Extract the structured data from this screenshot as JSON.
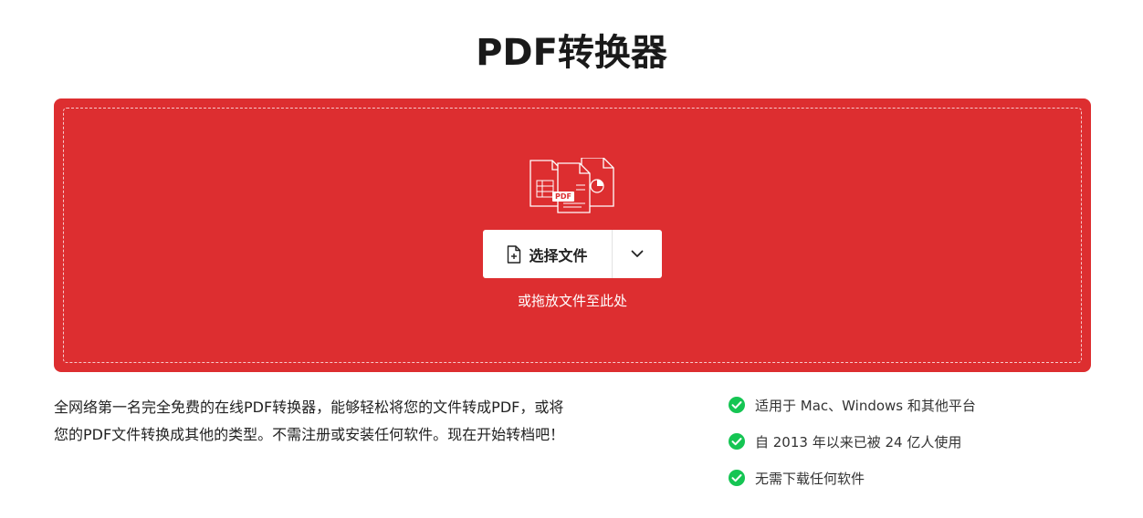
{
  "page": {
    "title": "PDF转换器"
  },
  "colors": {
    "brand_red": "#dd2e30",
    "check_green": "#15c553"
  },
  "dropzone": {
    "illustration_icon": "files-illustration",
    "illustration_badge": "PDF",
    "select_button": {
      "icon": "file-add-icon",
      "label": "选择文件"
    },
    "more_options": {
      "icon": "chevron-down-icon"
    },
    "drop_hint": "或拖放文件至此处"
  },
  "description": {
    "line1": "全网络第一名完全免费的在线PDF转换器，能够轻松将您的文件转成PDF，或将",
    "line2": "您的PDF文件转换成其他的类型。不需注册或安装任何软件。现在开始转档吧！"
  },
  "features": [
    {
      "icon": "check-circle-icon",
      "text": "适用于 Mac、Windows 和其他平台"
    },
    {
      "icon": "check-circle-icon",
      "text": "自 2013 年以来已被 24 亿人使用"
    },
    {
      "icon": "check-circle-icon",
      "text": "无需下载任何软件"
    }
  ]
}
